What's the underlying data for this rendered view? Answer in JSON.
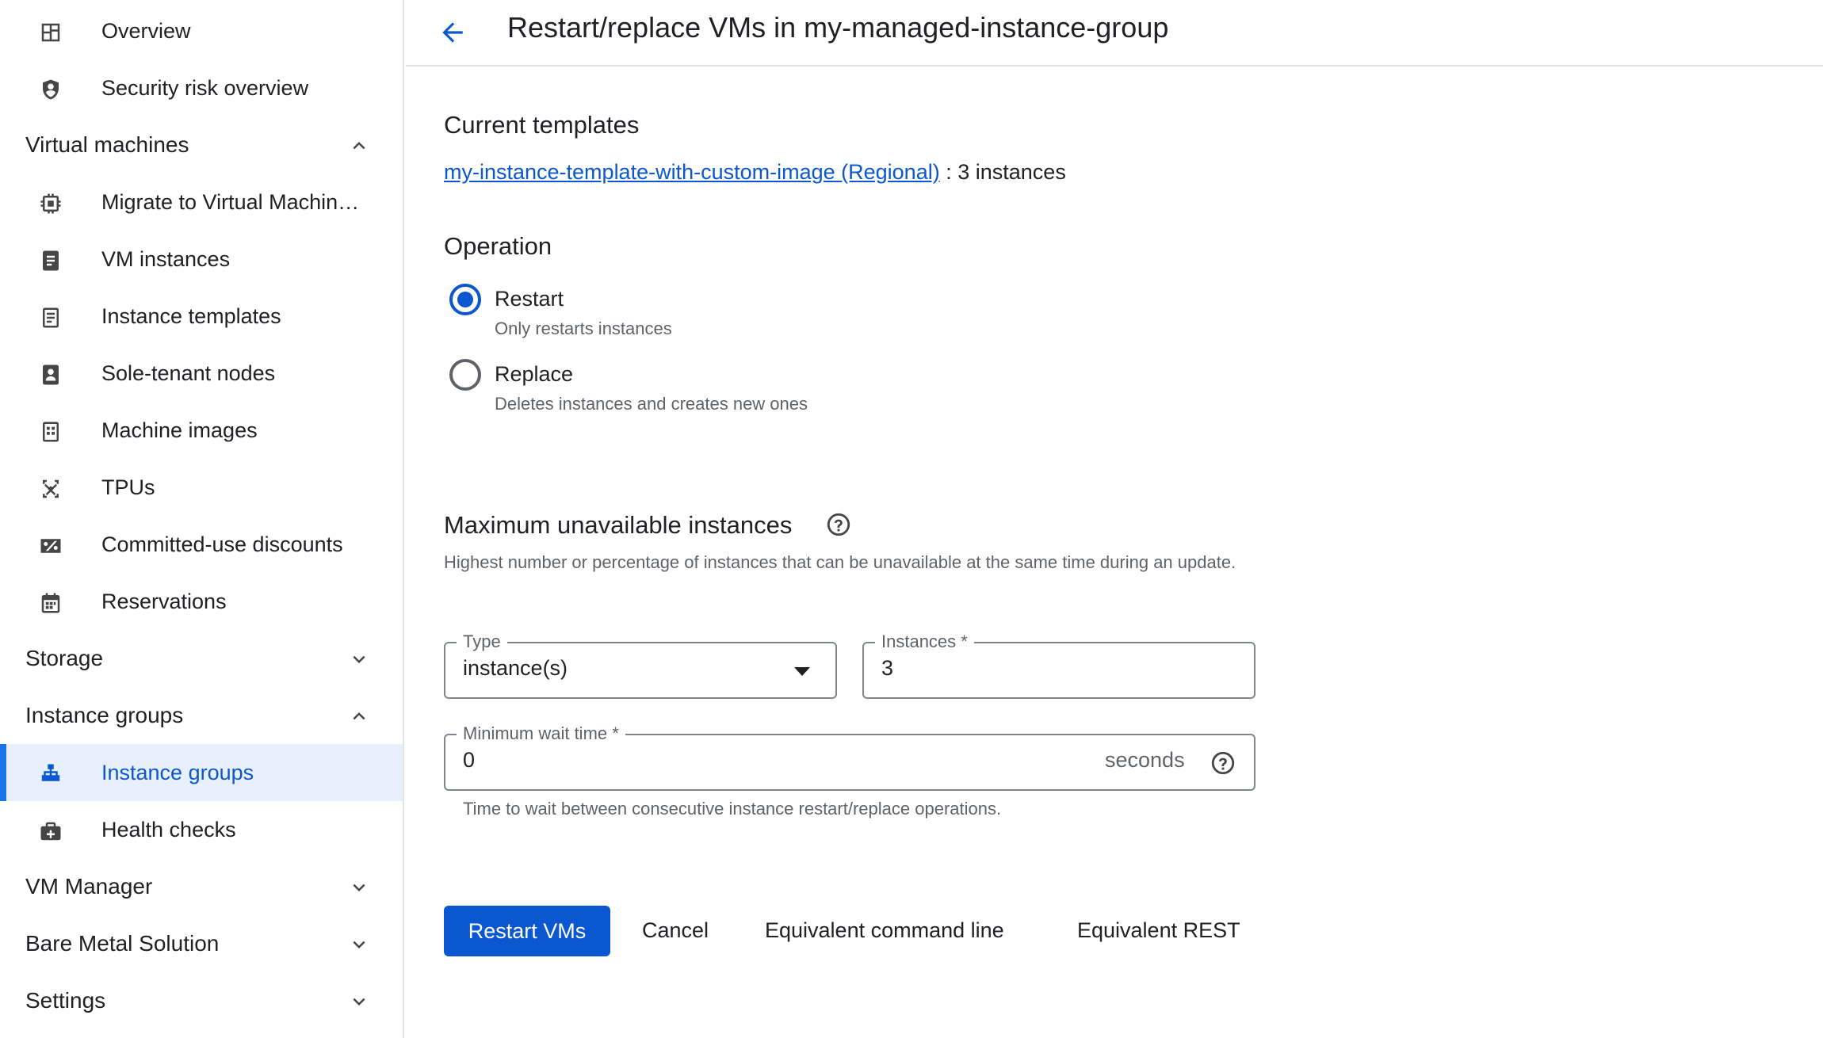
{
  "sidebar": {
    "items": [
      {
        "label": "Overview",
        "icon": "dashboard-icon"
      },
      {
        "label": "Security risk overview",
        "icon": "shield-icon"
      },
      {
        "label": "Virtual machines",
        "section": true,
        "expanded": true
      },
      {
        "label": "Migrate to Virtual Machin…",
        "icon": "migrate-chip-icon"
      },
      {
        "label": "VM instances",
        "icon": "vm-instance-icon"
      },
      {
        "label": "Instance templates",
        "icon": "instance-template-icon"
      },
      {
        "label": "Sole-tenant nodes",
        "icon": "sole-tenant-icon"
      },
      {
        "label": "Machine images",
        "icon": "machine-image-icon"
      },
      {
        "label": "TPUs",
        "icon": "tpu-icon"
      },
      {
        "label": "Committed-use discounts",
        "icon": "percent-icon"
      },
      {
        "label": "Reservations",
        "icon": "calendar-icon"
      },
      {
        "label": "Storage",
        "section": true,
        "expanded": false
      },
      {
        "label": "Instance groups",
        "section": true,
        "expanded": true
      },
      {
        "label": "Instance groups",
        "icon": "instance-groups-icon",
        "selected": true
      },
      {
        "label": "Health checks",
        "icon": "health-check-icon"
      },
      {
        "label": "VM Manager",
        "section": true,
        "expanded": false
      },
      {
        "label": "Bare Metal Solution",
        "section": true,
        "expanded": false
      },
      {
        "label": "Settings",
        "section": true,
        "expanded": false
      }
    ]
  },
  "header": {
    "title": "Restart/replace VMs in my-managed-instance-group",
    "back_icon": "arrow-back-icon"
  },
  "templates": {
    "heading": "Current templates",
    "link_text": "my-instance-template-with-custom-image (Regional)",
    "count_text": ": 3 instances"
  },
  "operation": {
    "heading": "Operation",
    "options": [
      {
        "label": "Restart",
        "description": "Only restarts instances",
        "selected": true
      },
      {
        "label": "Replace",
        "description": "Deletes instances and creates new ones",
        "selected": false
      }
    ]
  },
  "max_unavailable": {
    "heading": "Maximum unavailable instances",
    "description": "Highest number or percentage of instances that can be unavailable at the same time during an update.",
    "type_label": "Type",
    "type_value": "instance(s)",
    "instances_label": "Instances *",
    "instances_value": "3"
  },
  "min_wait": {
    "label": "Minimum wait time *",
    "value": "0",
    "suffix": "seconds",
    "hint": "Time to wait between consecutive instance restart/replace operations."
  },
  "actions": {
    "primary": "Restart VMs",
    "cancel": "Cancel",
    "command_line": "Equivalent command line",
    "rest": "Equivalent REST"
  },
  "colors": {
    "accent": "#0b57d0",
    "selected_bg": "#e8f0fe"
  }
}
